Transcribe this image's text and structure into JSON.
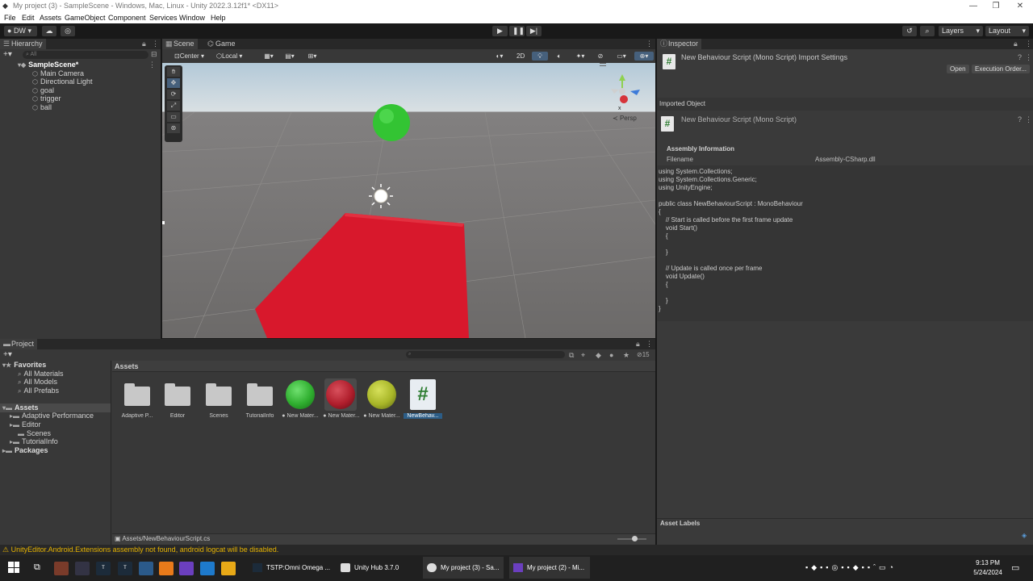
{
  "window": {
    "title": "My project (3) - SampleScene - Windows, Mac, Linux - Unity 2022.3.12f1* <DX11>"
  },
  "menu": [
    "File",
    "Edit",
    "Assets",
    "GameObject",
    "Component",
    "Services",
    "Window",
    "Help"
  ],
  "toolbar": {
    "account": "DW",
    "layers": "Layers",
    "layout": "Layout"
  },
  "hierarchy": {
    "tab": "Hierarchy",
    "search_placeholder": "All",
    "scene": "SampleScene*",
    "items": [
      "Main Camera",
      "Directional Light",
      "goal",
      "trigger",
      "ball"
    ]
  },
  "scene_view": {
    "tabs": [
      "Scene",
      "Game"
    ],
    "pivot": "Center",
    "space": "Local",
    "mode_2d": "2D",
    "persp": "Persp",
    "gizmo_x": "x"
  },
  "inspector": {
    "tab": "Inspector",
    "header": "New Behaviour Script (Mono Script) Import Settings",
    "open": "Open",
    "exec_order": "Execution Order...",
    "imported_object": "Imported Object",
    "script_title": "New Behaviour Script (Mono Script)",
    "assembly_info": "Assembly Information",
    "filename_label": "Filename",
    "filename_value": "Assembly-CSharp.dll",
    "code": [
      "using System.Collections;",
      "using System.Collections.Generic;",
      "using UnityEngine;",
      "",
      "public class NewBehaviourScript : MonoBehaviour",
      "{",
      "    // Start is called before the first frame update",
      "    void Start()",
      "    {",
      "",
      "    }",
      "",
      "    // Update is called once per frame",
      "    void Update()",
      "    {",
      "",
      "    }",
      "}"
    ],
    "asset_labels": "Asset Labels"
  },
  "project": {
    "tab": "Project",
    "hidden_count": "15",
    "favorites": "Favorites",
    "favorite_items": [
      "All Materials",
      "All Models",
      "All Prefabs"
    ],
    "assets_root": "Assets",
    "asset_folders": [
      "Adaptive Performance",
      "Editor",
      "Scenes",
      "TutorialInfo"
    ],
    "packages": "Packages",
    "breadcrumb": "Assets",
    "grid": [
      {
        "label": "Adaptive P..."
      },
      {
        "label": "Editor"
      },
      {
        "label": "Scenes"
      },
      {
        "label": "TutorialInfo"
      },
      {
        "label": "New Mater...",
        "color": "#2fae2f"
      },
      {
        "label": "New Mater...",
        "color": "#b01e2c"
      },
      {
        "label": "New Mater...",
        "color": "#a8b628"
      },
      {
        "label": "NewBehav..."
      }
    ],
    "path": "Assets/NewBehaviourScript.cs"
  },
  "console_warning": "UnityEditor.Android.Extensions assembly not found, android logcat will be disabled.",
  "taskbar": {
    "apps": [
      "TSTP:Omni Omega ...",
      "Unity Hub 3.7.0",
      "My project (3) - Sa...",
      "My project (2) - Mi..."
    ],
    "time": "9:13 PM",
    "date": "5/24/2024"
  },
  "colors": {
    "accent_green": "#2ecc2e",
    "cube_red": "#d8182c",
    "selection": "#2c5d87"
  }
}
